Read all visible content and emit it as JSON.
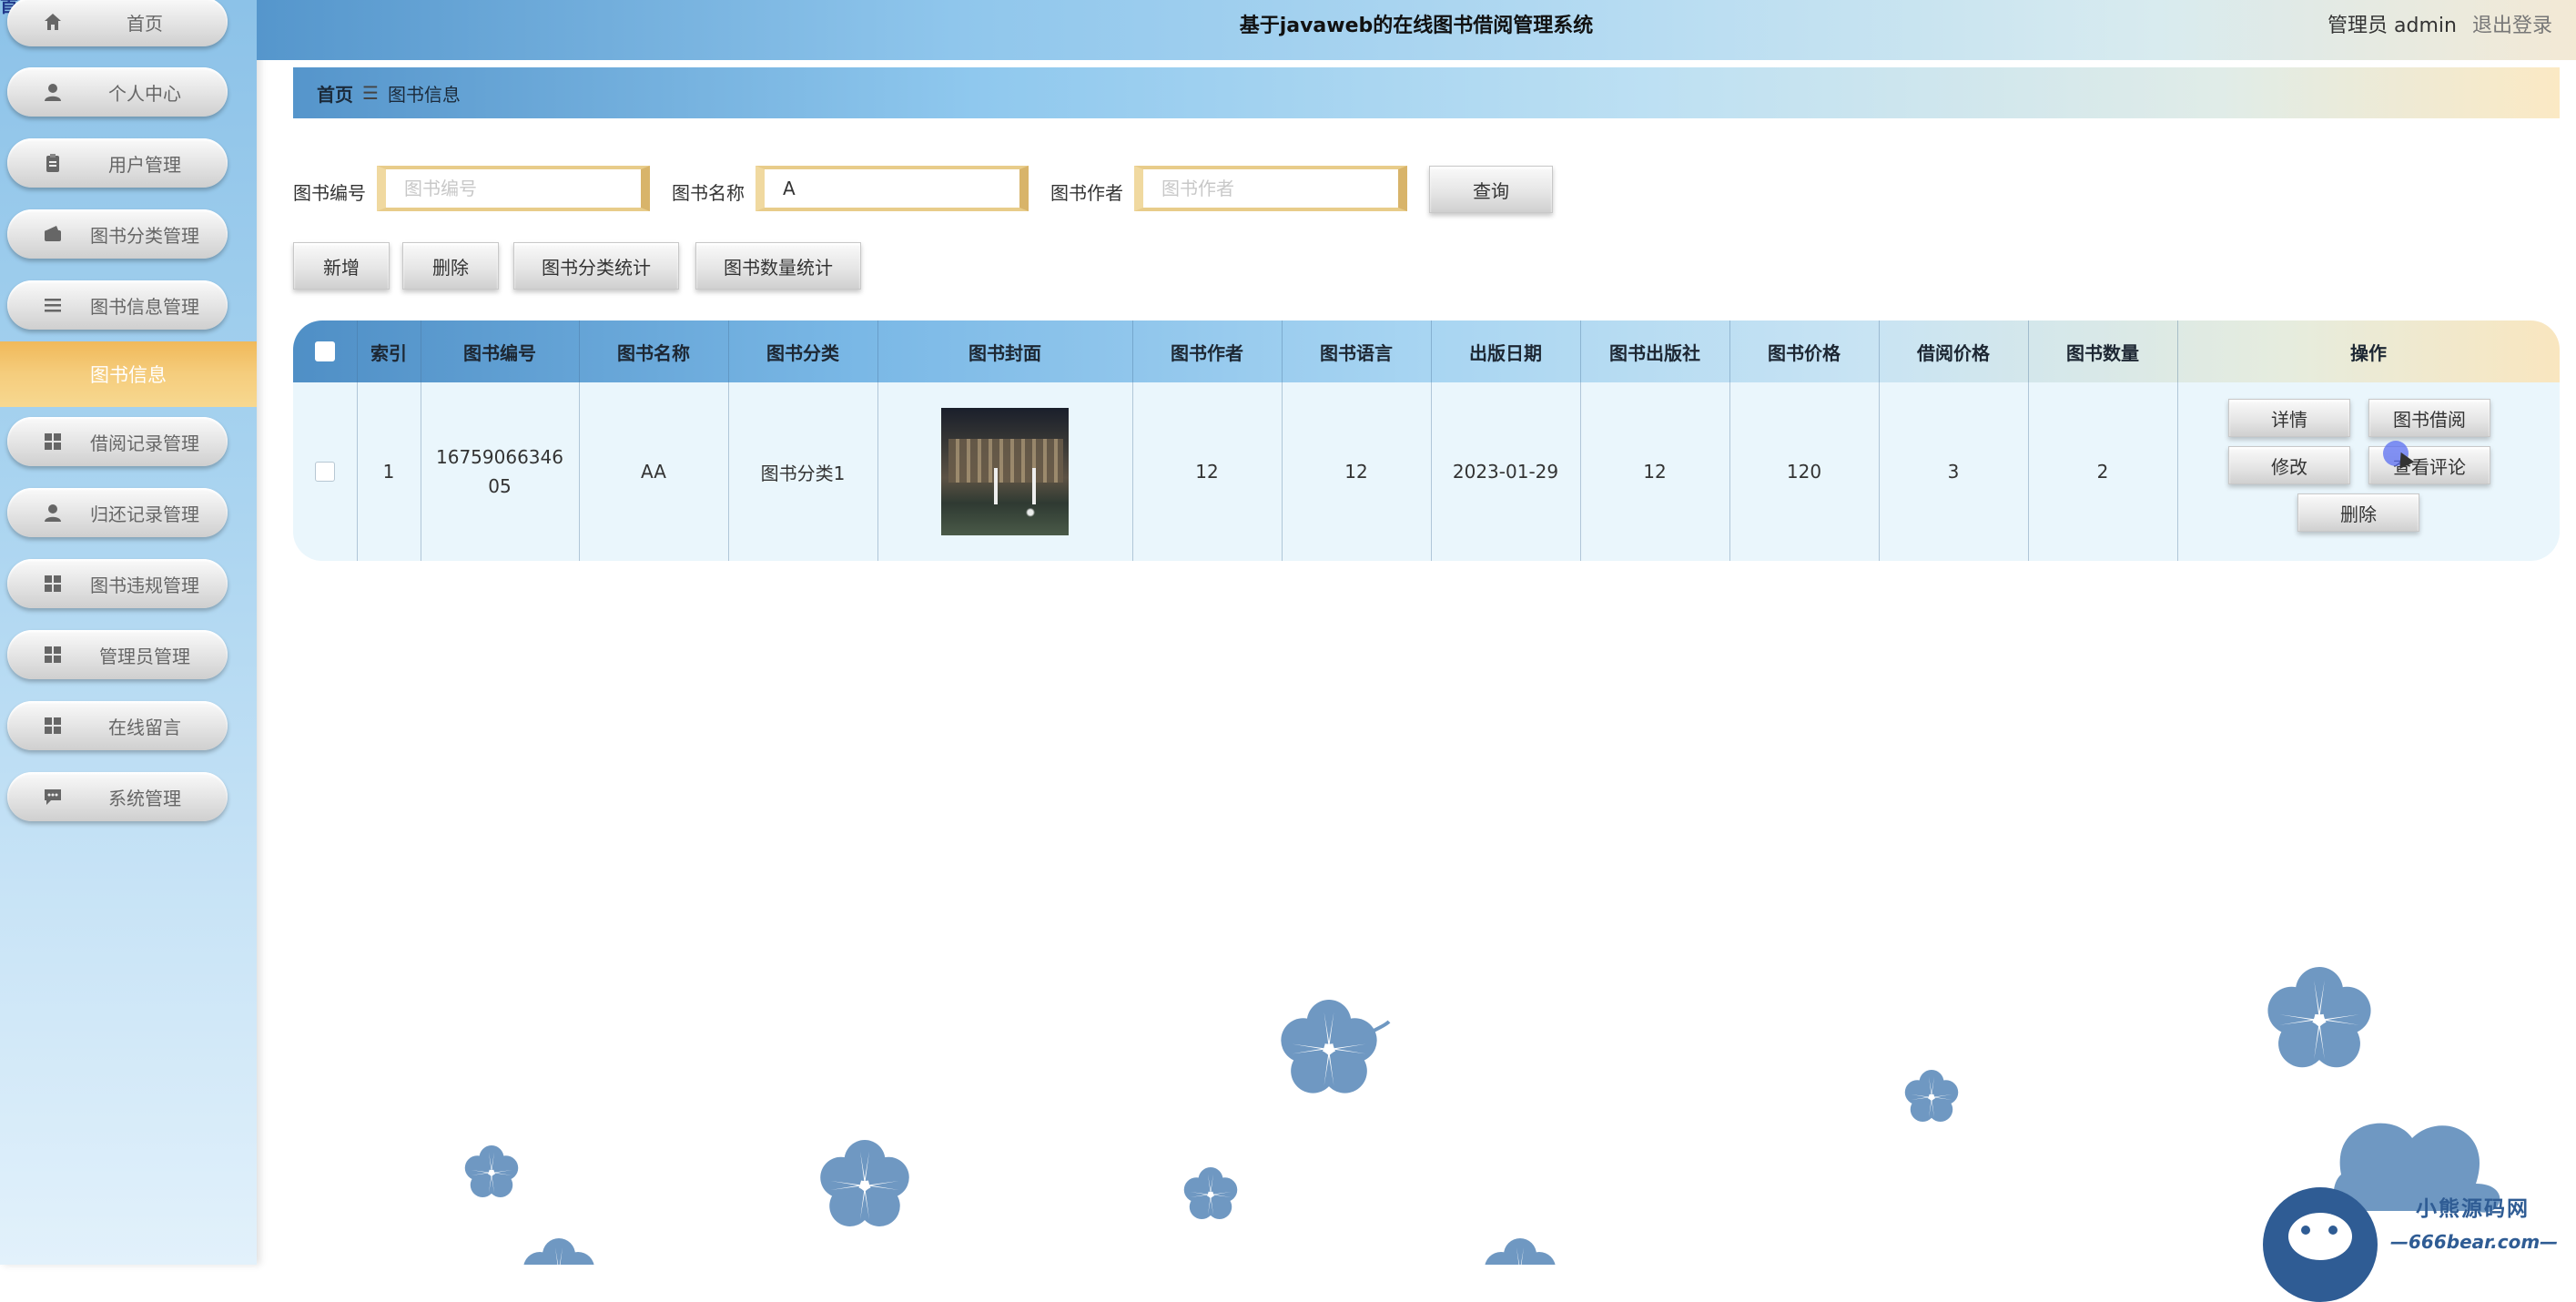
{
  "corner_glyph": "首页",
  "header": {
    "title": "基于javaweb的在线图书借阅管理系统",
    "user": "管理员 admin",
    "logout": "退出登录"
  },
  "sidebar": {
    "items": [
      {
        "label": "首页",
        "icon": "home-icon"
      },
      {
        "label": "个人中心",
        "icon": "user-icon"
      },
      {
        "label": "用户管理",
        "icon": "clipboard-icon"
      },
      {
        "label": "图书分类管理",
        "icon": "wallet-icon"
      },
      {
        "label": "图书信息管理",
        "icon": "list-icon"
      },
      {
        "label": "借阅记录管理",
        "icon": "grid-icon"
      },
      {
        "label": "归还记录管理",
        "icon": "user-icon"
      },
      {
        "label": "图书违规管理",
        "icon": "grid-icon"
      },
      {
        "label": "管理员管理",
        "icon": "grid-icon"
      },
      {
        "label": "在线留言",
        "icon": "grid-icon"
      },
      {
        "label": "系统管理",
        "icon": "message-icon"
      }
    ],
    "active_sub": "图书信息"
  },
  "breadcrumb": {
    "home": "首页",
    "sep": "☰",
    "current": "图书信息"
  },
  "search": {
    "book_no_label": "图书编号",
    "book_no_placeholder": "图书编号",
    "book_no_value": "",
    "book_name_label": "图书名称",
    "book_name_placeholder": "图书名称",
    "book_name_value": "A",
    "author_label": "图书作者",
    "author_placeholder": "图书作者",
    "author_value": "",
    "query_button": "查询"
  },
  "actions": {
    "add": "新增",
    "delete": "删除",
    "category_stats": "图书分类统计",
    "quantity_stats": "图书数量统计"
  },
  "table": {
    "headers": {
      "index": "索引",
      "book_no": "图书编号",
      "book_name": "图书名称",
      "category": "图书分类",
      "cover": "图书封面",
      "author": "图书作者",
      "language": "图书语言",
      "pub_date": "出版日期",
      "publisher": "图书出版社",
      "price": "图书价格",
      "borrow_price": "借阅价格",
      "quantity": "图书数量",
      "operations": "操作"
    },
    "rows": [
      {
        "index": "1",
        "book_no": "1675906634605",
        "book_name": "AA",
        "category": "图书分类1",
        "author": "12",
        "language": "12",
        "pub_date": "2023-01-29",
        "publisher": "12",
        "price": "120",
        "borrow_price": "3",
        "quantity": "2",
        "ops": {
          "detail": "详情",
          "borrow": "图书借阅",
          "edit": "修改",
          "comments": "查看评论",
          "delete": "删除"
        }
      }
    ]
  },
  "watermark": {
    "name": "小熊源码网",
    "url": "—666bear.com—"
  },
  "colors": {
    "accent_gold": "#f0b95a",
    "header_blue": "#5596cc",
    "flower_blue": "#6f98c2"
  }
}
